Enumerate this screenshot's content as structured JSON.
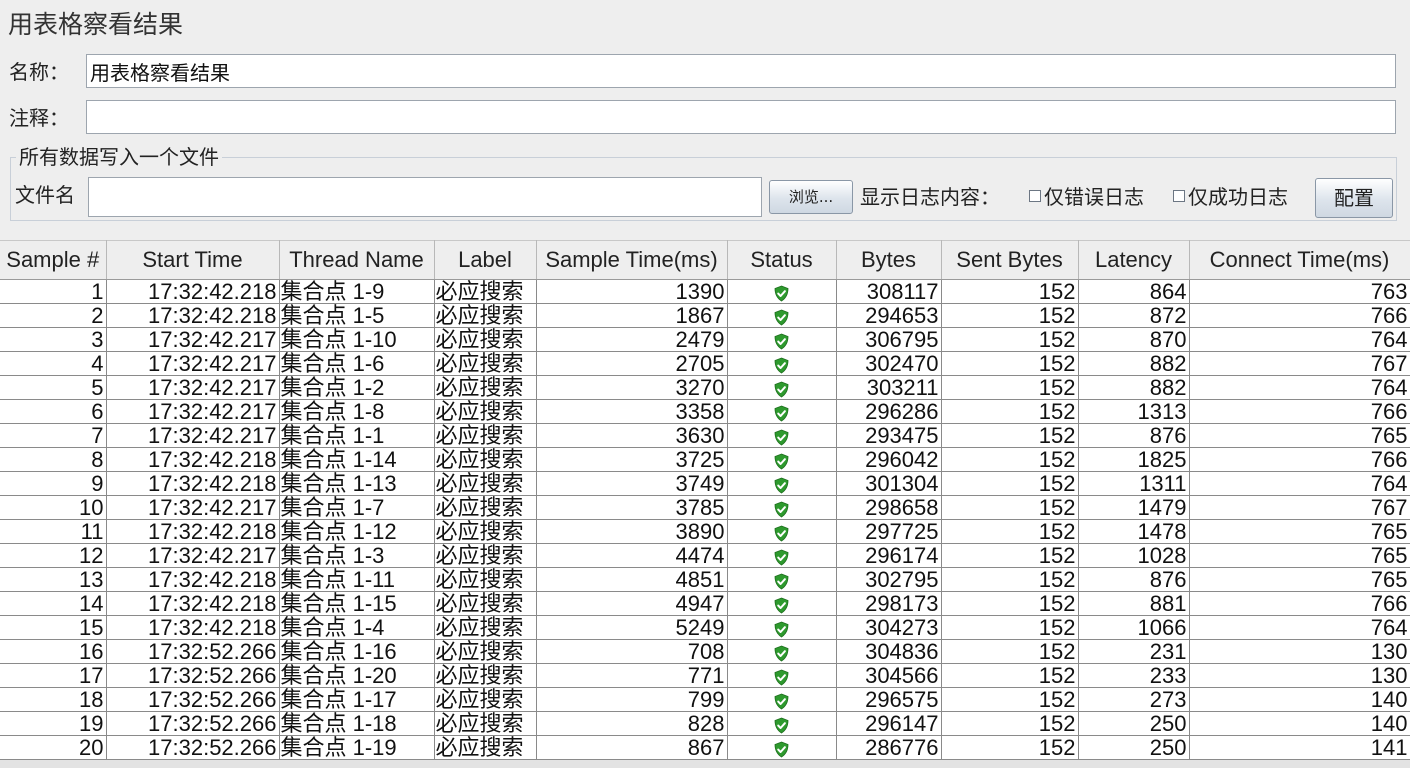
{
  "panel": {
    "title": "用表格察看结果"
  },
  "fields": {
    "name_label": "名称：",
    "name_value": "用表格察看结果",
    "comment_label": "注释：",
    "comment_value": ""
  },
  "file_section": {
    "legend": "所有数据写入一个文件",
    "file_label": "文件名",
    "file_value": "",
    "browse_button": "浏览...",
    "log_label": "显示日志内容：",
    "errors_only": "仅错误日志",
    "success_only": "仅成功日志",
    "config_button": "配置"
  },
  "table": {
    "columns": [
      "Sample #",
      "Start Time",
      "Thread Name",
      "Label",
      "Sample Time(ms)",
      "Status",
      "Bytes",
      "Sent Bytes",
      "Latency",
      "Connect Time(ms)"
    ],
    "status_icon": "shield-check-icon",
    "status_color": "#2e9a2e",
    "rows": [
      {
        "sample": "1",
        "start": "17:32:42.218",
        "thread": "集合点 1-9",
        "label": "必应搜索",
        "time": "1390",
        "bytes": "308117",
        "sent": "152",
        "latency": "864",
        "connect": "763"
      },
      {
        "sample": "2",
        "start": "17:32:42.218",
        "thread": "集合点 1-5",
        "label": "必应搜索",
        "time": "1867",
        "bytes": "294653",
        "sent": "152",
        "latency": "872",
        "connect": "766"
      },
      {
        "sample": "3",
        "start": "17:32:42.217",
        "thread": "集合点 1-10",
        "label": "必应搜索",
        "time": "2479",
        "bytes": "306795",
        "sent": "152",
        "latency": "870",
        "connect": "764"
      },
      {
        "sample": "4",
        "start": "17:32:42.217",
        "thread": "集合点 1-6",
        "label": "必应搜索",
        "time": "2705",
        "bytes": "302470",
        "sent": "152",
        "latency": "882",
        "connect": "767"
      },
      {
        "sample": "5",
        "start": "17:32:42.217",
        "thread": "集合点 1-2",
        "label": "必应搜索",
        "time": "3270",
        "bytes": "303211",
        "sent": "152",
        "latency": "882",
        "connect": "764"
      },
      {
        "sample": "6",
        "start": "17:32:42.217",
        "thread": "集合点 1-8",
        "label": "必应搜索",
        "time": "3358",
        "bytes": "296286",
        "sent": "152",
        "latency": "1313",
        "connect": "766"
      },
      {
        "sample": "7",
        "start": "17:32:42.217",
        "thread": "集合点 1-1",
        "label": "必应搜索",
        "time": "3630",
        "bytes": "293475",
        "sent": "152",
        "latency": "876",
        "connect": "765"
      },
      {
        "sample": "8",
        "start": "17:32:42.218",
        "thread": "集合点 1-14",
        "label": "必应搜索",
        "time": "3725",
        "bytes": "296042",
        "sent": "152",
        "latency": "1825",
        "connect": "766"
      },
      {
        "sample": "9",
        "start": "17:32:42.218",
        "thread": "集合点 1-13",
        "label": "必应搜索",
        "time": "3749",
        "bytes": "301304",
        "sent": "152",
        "latency": "1311",
        "connect": "764"
      },
      {
        "sample": "10",
        "start": "17:32:42.217",
        "thread": "集合点 1-7",
        "label": "必应搜索",
        "time": "3785",
        "bytes": "298658",
        "sent": "152",
        "latency": "1479",
        "connect": "767"
      },
      {
        "sample": "11",
        "start": "17:32:42.218",
        "thread": "集合点 1-12",
        "label": "必应搜索",
        "time": "3890",
        "bytes": "297725",
        "sent": "152",
        "latency": "1478",
        "connect": "765"
      },
      {
        "sample": "12",
        "start": "17:32:42.217",
        "thread": "集合点 1-3",
        "label": "必应搜索",
        "time": "4474",
        "bytes": "296174",
        "sent": "152",
        "latency": "1028",
        "connect": "765"
      },
      {
        "sample": "13",
        "start": "17:32:42.218",
        "thread": "集合点 1-11",
        "label": "必应搜索",
        "time": "4851",
        "bytes": "302795",
        "sent": "152",
        "latency": "876",
        "connect": "765"
      },
      {
        "sample": "14",
        "start": "17:32:42.218",
        "thread": "集合点 1-15",
        "label": "必应搜索",
        "time": "4947",
        "bytes": "298173",
        "sent": "152",
        "latency": "881",
        "connect": "766"
      },
      {
        "sample": "15",
        "start": "17:32:42.218",
        "thread": "集合点 1-4",
        "label": "必应搜索",
        "time": "5249",
        "bytes": "304273",
        "sent": "152",
        "latency": "1066",
        "connect": "764"
      },
      {
        "sample": "16",
        "start": "17:32:52.266",
        "thread": "集合点 1-16",
        "label": "必应搜索",
        "time": "708",
        "bytes": "304836",
        "sent": "152",
        "latency": "231",
        "connect": "130"
      },
      {
        "sample": "17",
        "start": "17:32:52.266",
        "thread": "集合点 1-20",
        "label": "必应搜索",
        "time": "771",
        "bytes": "304566",
        "sent": "152",
        "latency": "233",
        "connect": "130"
      },
      {
        "sample": "18",
        "start": "17:32:52.266",
        "thread": "集合点 1-17",
        "label": "必应搜索",
        "time": "799",
        "bytes": "296575",
        "sent": "152",
        "latency": "273",
        "connect": "140"
      },
      {
        "sample": "19",
        "start": "17:32:52.266",
        "thread": "集合点 1-18",
        "label": "必应搜索",
        "time": "828",
        "bytes": "296147",
        "sent": "152",
        "latency": "250",
        "connect": "140"
      },
      {
        "sample": "20",
        "start": "17:32:52.266",
        "thread": "集合点 1-19",
        "label": "必应搜索",
        "time": "867",
        "bytes": "286776",
        "sent": "152",
        "latency": "250",
        "connect": "141"
      }
    ]
  }
}
